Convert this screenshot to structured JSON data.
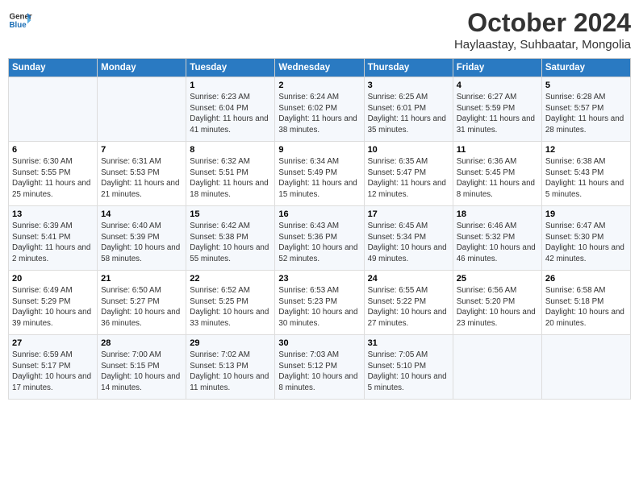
{
  "header": {
    "logo_line1": "General",
    "logo_line2": "Blue",
    "month_title": "October 2024",
    "location": "Haylaastay, Suhbaatar, Mongolia"
  },
  "days_of_week": [
    "Sunday",
    "Monday",
    "Tuesday",
    "Wednesday",
    "Thursday",
    "Friday",
    "Saturday"
  ],
  "weeks": [
    [
      {
        "day": "",
        "info": ""
      },
      {
        "day": "",
        "info": ""
      },
      {
        "day": "1",
        "info": "Sunrise: 6:23 AM\nSunset: 6:04 PM\nDaylight: 11 hours and 41 minutes."
      },
      {
        "day": "2",
        "info": "Sunrise: 6:24 AM\nSunset: 6:02 PM\nDaylight: 11 hours and 38 minutes."
      },
      {
        "day": "3",
        "info": "Sunrise: 6:25 AM\nSunset: 6:01 PM\nDaylight: 11 hours and 35 minutes."
      },
      {
        "day": "4",
        "info": "Sunrise: 6:27 AM\nSunset: 5:59 PM\nDaylight: 11 hours and 31 minutes."
      },
      {
        "day": "5",
        "info": "Sunrise: 6:28 AM\nSunset: 5:57 PM\nDaylight: 11 hours and 28 minutes."
      }
    ],
    [
      {
        "day": "6",
        "info": "Sunrise: 6:30 AM\nSunset: 5:55 PM\nDaylight: 11 hours and 25 minutes."
      },
      {
        "day": "7",
        "info": "Sunrise: 6:31 AM\nSunset: 5:53 PM\nDaylight: 11 hours and 21 minutes."
      },
      {
        "day": "8",
        "info": "Sunrise: 6:32 AM\nSunset: 5:51 PM\nDaylight: 11 hours and 18 minutes."
      },
      {
        "day": "9",
        "info": "Sunrise: 6:34 AM\nSunset: 5:49 PM\nDaylight: 11 hours and 15 minutes."
      },
      {
        "day": "10",
        "info": "Sunrise: 6:35 AM\nSunset: 5:47 PM\nDaylight: 11 hours and 12 minutes."
      },
      {
        "day": "11",
        "info": "Sunrise: 6:36 AM\nSunset: 5:45 PM\nDaylight: 11 hours and 8 minutes."
      },
      {
        "day": "12",
        "info": "Sunrise: 6:38 AM\nSunset: 5:43 PM\nDaylight: 11 hours and 5 minutes."
      }
    ],
    [
      {
        "day": "13",
        "info": "Sunrise: 6:39 AM\nSunset: 5:41 PM\nDaylight: 11 hours and 2 minutes."
      },
      {
        "day": "14",
        "info": "Sunrise: 6:40 AM\nSunset: 5:39 PM\nDaylight: 10 hours and 58 minutes."
      },
      {
        "day": "15",
        "info": "Sunrise: 6:42 AM\nSunset: 5:38 PM\nDaylight: 10 hours and 55 minutes."
      },
      {
        "day": "16",
        "info": "Sunrise: 6:43 AM\nSunset: 5:36 PM\nDaylight: 10 hours and 52 minutes."
      },
      {
        "day": "17",
        "info": "Sunrise: 6:45 AM\nSunset: 5:34 PM\nDaylight: 10 hours and 49 minutes."
      },
      {
        "day": "18",
        "info": "Sunrise: 6:46 AM\nSunset: 5:32 PM\nDaylight: 10 hours and 46 minutes."
      },
      {
        "day": "19",
        "info": "Sunrise: 6:47 AM\nSunset: 5:30 PM\nDaylight: 10 hours and 42 minutes."
      }
    ],
    [
      {
        "day": "20",
        "info": "Sunrise: 6:49 AM\nSunset: 5:29 PM\nDaylight: 10 hours and 39 minutes."
      },
      {
        "day": "21",
        "info": "Sunrise: 6:50 AM\nSunset: 5:27 PM\nDaylight: 10 hours and 36 minutes."
      },
      {
        "day": "22",
        "info": "Sunrise: 6:52 AM\nSunset: 5:25 PM\nDaylight: 10 hours and 33 minutes."
      },
      {
        "day": "23",
        "info": "Sunrise: 6:53 AM\nSunset: 5:23 PM\nDaylight: 10 hours and 30 minutes."
      },
      {
        "day": "24",
        "info": "Sunrise: 6:55 AM\nSunset: 5:22 PM\nDaylight: 10 hours and 27 minutes."
      },
      {
        "day": "25",
        "info": "Sunrise: 6:56 AM\nSunset: 5:20 PM\nDaylight: 10 hours and 23 minutes."
      },
      {
        "day": "26",
        "info": "Sunrise: 6:58 AM\nSunset: 5:18 PM\nDaylight: 10 hours and 20 minutes."
      }
    ],
    [
      {
        "day": "27",
        "info": "Sunrise: 6:59 AM\nSunset: 5:17 PM\nDaylight: 10 hours and 17 minutes."
      },
      {
        "day": "28",
        "info": "Sunrise: 7:00 AM\nSunset: 5:15 PM\nDaylight: 10 hours and 14 minutes."
      },
      {
        "day": "29",
        "info": "Sunrise: 7:02 AM\nSunset: 5:13 PM\nDaylight: 10 hours and 11 minutes."
      },
      {
        "day": "30",
        "info": "Sunrise: 7:03 AM\nSunset: 5:12 PM\nDaylight: 10 hours and 8 minutes."
      },
      {
        "day": "31",
        "info": "Sunrise: 7:05 AM\nSunset: 5:10 PM\nDaylight: 10 hours and 5 minutes."
      },
      {
        "day": "",
        "info": ""
      },
      {
        "day": "",
        "info": ""
      }
    ]
  ]
}
